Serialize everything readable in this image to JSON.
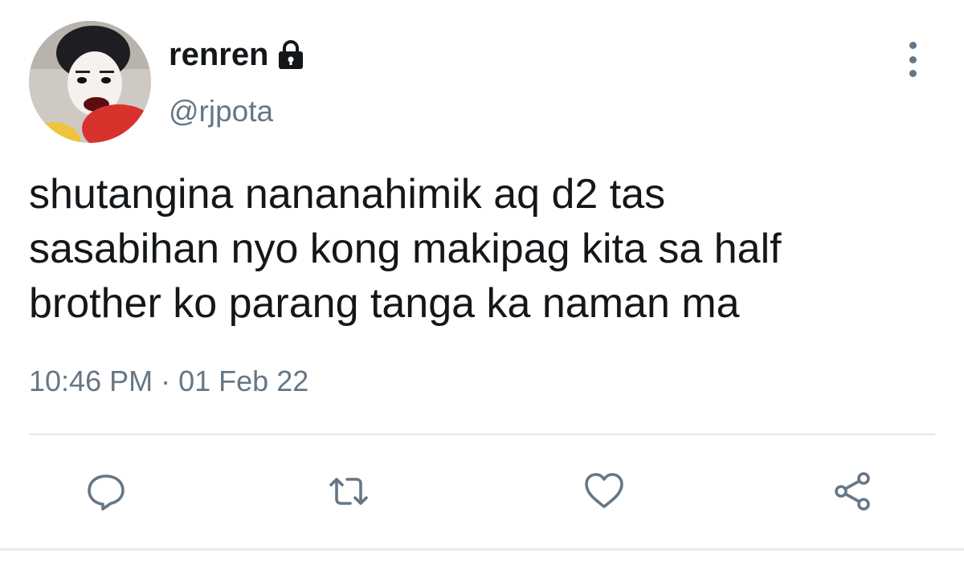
{
  "user": {
    "display_name": "renren",
    "handle": "@rjpota",
    "protected_icon": "lock-icon",
    "avatar": "avatar-photo"
  },
  "tweet": {
    "text": "shutangina nananahimik aq d2 tas\nsasabihan nyo kong makipag kita sa half\nbrother ko parang tanga ka naman ma",
    "time": "10:46 PM",
    "separator": "·",
    "date": "01 Feb 22"
  },
  "actions": [
    {
      "name": "reply",
      "icon": "reply-icon"
    },
    {
      "name": "retweet",
      "icon": "retweet-icon"
    },
    {
      "name": "like",
      "icon": "heart-icon"
    },
    {
      "name": "share",
      "icon": "share-icon"
    }
  ],
  "menu_icon": "more-options-icon",
  "colors": {
    "text": "#14171a",
    "secondary": "#657786",
    "divider": "#e1e8ed",
    "background": "#ffffff"
  }
}
